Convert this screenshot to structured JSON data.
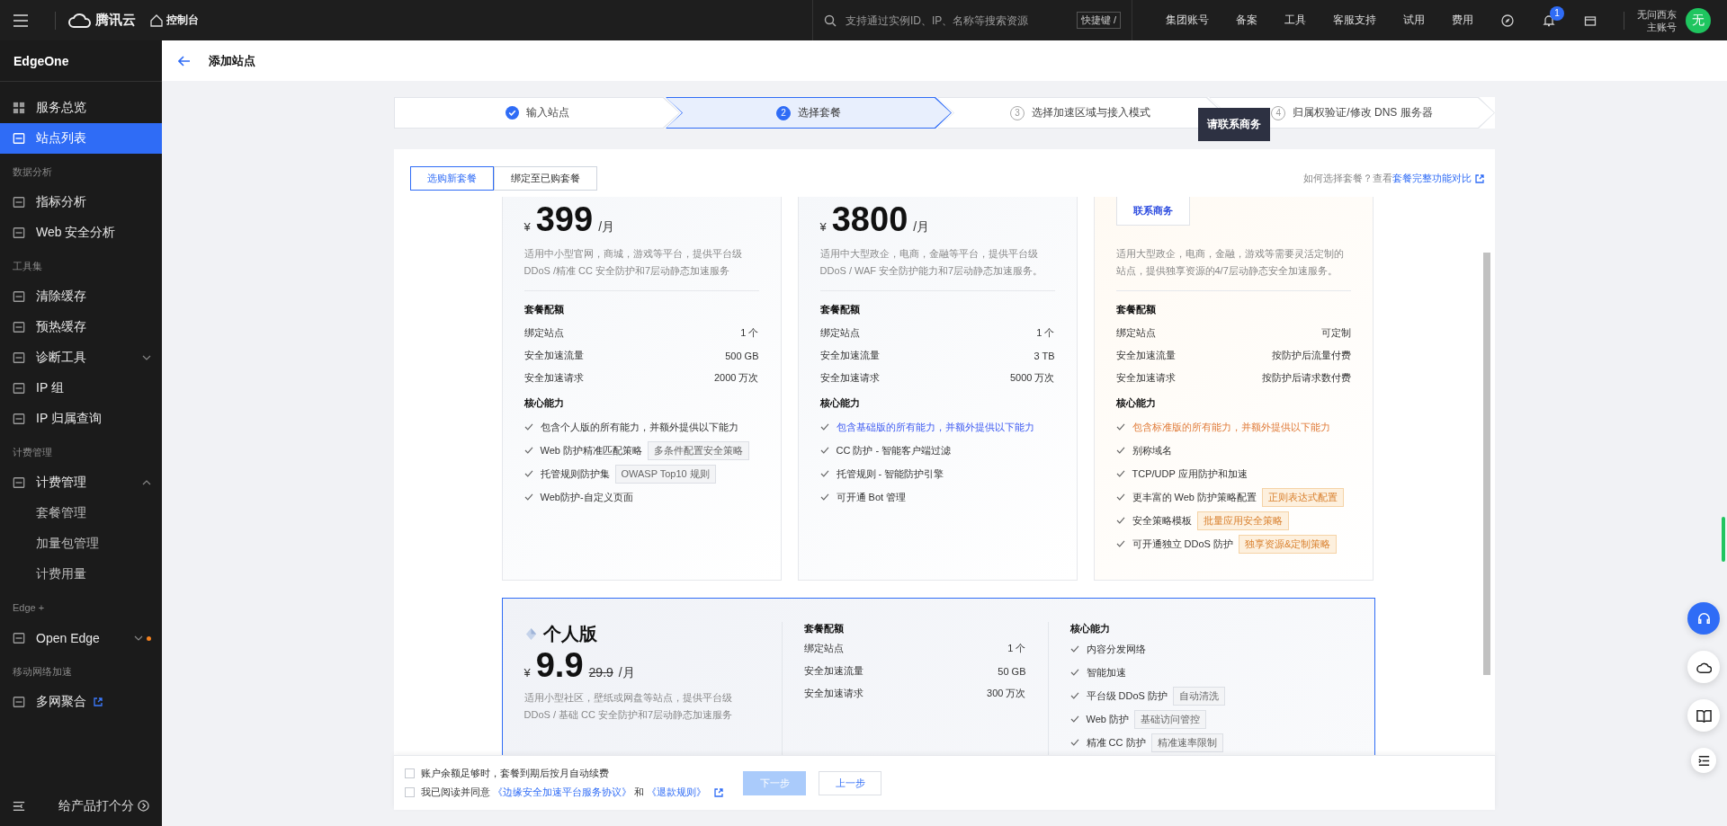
{
  "topbar": {
    "brand": "腾讯云",
    "console": "控制台",
    "search": {
      "placeholder": "支持通过实例ID、IP、名称等搜索资源"
    },
    "shortcut": "快捷键 /",
    "links": [
      "集团账号",
      "备案",
      "工具",
      "客服支持",
      "试用",
      "费用"
    ],
    "notification_count": "1",
    "account": {
      "name": "无问西东",
      "role": "主账号",
      "avatar": "无"
    }
  },
  "sidebar": {
    "product": "EdgeOne",
    "items": [
      {
        "kind": "item",
        "label": "服务总览",
        "selected": false
      },
      {
        "kind": "item",
        "label": "站点列表",
        "selected": true
      },
      {
        "kind": "heading",
        "label": "数据分析"
      },
      {
        "kind": "item",
        "label": "指标分析",
        "selected": false
      },
      {
        "kind": "item",
        "label": "Web 安全分析",
        "selected": false
      },
      {
        "kind": "heading",
        "label": "工具集"
      },
      {
        "kind": "item",
        "label": "清除缓存",
        "selected": false
      },
      {
        "kind": "item",
        "label": "预热缓存",
        "selected": false
      },
      {
        "kind": "item",
        "label": "诊断工具",
        "selected": false,
        "expanded": false
      },
      {
        "kind": "item",
        "label": "IP 组",
        "selected": false
      },
      {
        "kind": "item",
        "label": "IP 归属查询",
        "selected": false
      },
      {
        "kind": "heading",
        "label": "计费管理"
      },
      {
        "kind": "item",
        "label": "计费管理",
        "selected": false,
        "expanded": true
      },
      {
        "kind": "subitem",
        "label": "套餐管理",
        "selected": false
      },
      {
        "kind": "subitem",
        "label": "加量包管理",
        "selected": false
      },
      {
        "kind": "subitem",
        "label": "计费用量",
        "selected": false
      },
      {
        "kind": "heading",
        "label": "Edge +"
      },
      {
        "kind": "item",
        "label": "Open Edge",
        "selected": false,
        "expanded": false,
        "notice_dot": true
      },
      {
        "kind": "heading",
        "label": "移动网络加速"
      },
      {
        "kind": "item",
        "label": "多网聚合",
        "selected": false,
        "external": true
      }
    ],
    "feedback": "给产品打个分"
  },
  "page": {
    "title": "添加站点"
  },
  "steps": [
    {
      "done": true,
      "selected": false,
      "label": "输入站点"
    },
    {
      "done": false,
      "selected": true,
      "number": "2",
      "label": "选择套餐"
    },
    {
      "done": false,
      "selected": false,
      "number": "3",
      "label": "选择加速区域与接入模式"
    },
    {
      "done": false,
      "selected": false,
      "number": "4",
      "label": "归属权验证/修改 DNS 服务器"
    }
  ],
  "tooltip": "请联系商务",
  "tabs": [
    {
      "label": "选购新套餐",
      "selected": true
    },
    {
      "label": "绑定至已购套餐",
      "selected": false
    }
  ],
  "help": {
    "text": "如何选择套餐？查看",
    "link": "套餐完整功能对比"
  },
  "plans": [
    {
      "kind": "price",
      "selected": false,
      "currency": "¥",
      "price": "399",
      "unit": "/月",
      "description": "适用中小型官网，商城，游戏等平台，提供平台级 DDoS /精准 CC 安全防护和7层动静态加速服务",
      "quota_heading": "套餐配额",
      "quotas": [
        {
          "name": "绑定站点",
          "value": "1 个"
        },
        {
          "name": "安全加速流量",
          "value": "500 GB"
        },
        {
          "name": "安全加速请求",
          "value": "2000 万次"
        }
      ],
      "features_heading": "核心能力",
      "features": [
        {
          "text": "包含个人版的所有能力，并额外提供以下能力",
          "emphasis": false
        },
        {
          "text": "Web 防护精准匹配策略",
          "tag": "多条件配置安全策略"
        },
        {
          "text": "托管规则防护集",
          "tag": "OWASP Top10 规则"
        },
        {
          "text": "Web防护-自定义页面"
        }
      ]
    },
    {
      "kind": "price",
      "selected": false,
      "currency": "¥",
      "price": "3800",
      "unit": "/月",
      "description": "适用中大型政企，电商，金融等平台，提供平台级 DDoS / WAF 安全防护能力和7层动静态加速服务。",
      "quota_heading": "套餐配额",
      "quotas": [
        {
          "name": "绑定站点",
          "value": "1 个"
        },
        {
          "name": "安全加速流量",
          "value": "3 TB"
        },
        {
          "name": "安全加速请求",
          "value": "5000 万次"
        }
      ],
      "features_heading": "核心能力",
      "features": [
        {
          "text": "包含基础版的所有能力，并额外提供以下能力",
          "emphasis": true
        },
        {
          "text": "CC 防护 - 智能客户端过滤"
        },
        {
          "text": "托管规则 - 智能防护引擎"
        },
        {
          "text": "可开通 Bot 管理"
        }
      ]
    },
    {
      "kind": "contact",
      "selected": false,
      "button": "联系商务",
      "description": "适用大型政企，电商，金融，游戏等需要灵活定制的站点，提供独享资源的4/7层动静态安全加速服务。",
      "quota_heading": "套餐配额",
      "quotas": [
        {
          "name": "绑定站点",
          "value": "可定制"
        },
        {
          "name": "安全加速流量",
          "value": "按防护后流量付费"
        },
        {
          "name": "安全加速请求",
          "value": "按防护后请求数付费"
        }
      ],
      "features_heading": "核心能力",
      "features": [
        {
          "text": "包含标准版的所有能力，并额外提供以下能力",
          "emphasis": true
        },
        {
          "text": "别称域名"
        },
        {
          "text": "TCP/UDP 应用防护和加速"
        },
        {
          "text": "更丰富的 Web 防护策略配置",
          "tag": "正则表达式配置"
        },
        {
          "text": "安全策略模板",
          "tag": "批量应用安全策略"
        },
        {
          "text": "可开通独立 DDoS 防护",
          "tag": "独享资源&定制策略"
        }
      ]
    }
  ],
  "featured_plan": {
    "selected": true,
    "name": "个人版",
    "currency": "¥",
    "price": "9.9",
    "original_price": "29.9",
    "unit": "/月",
    "description": "适用小型社区，壁纸或网盘等站点，提供平台级 DDoS / 基础 CC 安全防护和7层动静态加速服务",
    "quota_heading": "套餐配额",
    "quotas": [
      {
        "name": "绑定站点",
        "value": "1 个"
      },
      {
        "name": "安全加速流量",
        "value": "50 GB"
      },
      {
        "name": "安全加速请求",
        "value": "300 万次"
      }
    ],
    "features_heading": "核心能力",
    "features": [
      {
        "text": "内容分发网络"
      },
      {
        "text": "智能加速"
      },
      {
        "text": "平台级 DDoS 防护",
        "tag": "自动清洗"
      },
      {
        "text": "Web 防护",
        "tag": "基础访问管控"
      },
      {
        "text": "精准 CC 防护",
        "tag": "精准速率限制"
      }
    ]
  },
  "footer": {
    "auto_renew": {
      "label": "账户余额足够时，套餐到期后按月自动续费",
      "checked": false
    },
    "agreement": {
      "checked": false,
      "text": "我已阅读并同意",
      "link1": "《边缘安全加速平台服务协议》",
      "joiner": "和",
      "link2": "《退款规则》"
    },
    "next": {
      "label": "下一步",
      "disabled": true
    },
    "back": {
      "label": "上一步"
    }
  }
}
